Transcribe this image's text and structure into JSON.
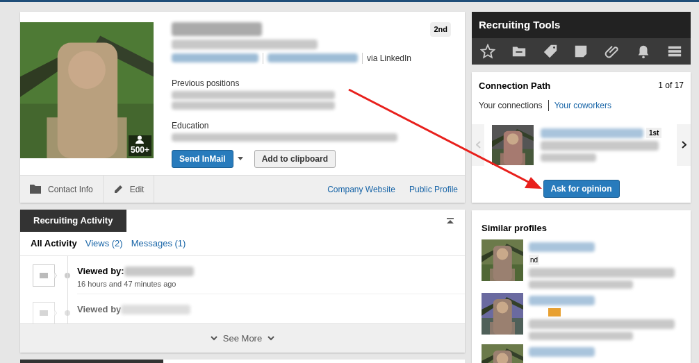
{
  "profile": {
    "degree": "2nd",
    "connections": "500+",
    "via": "via LinkedIn",
    "sections": [
      {
        "heading": "Previous positions"
      },
      {
        "heading": "Education"
      }
    ],
    "actions": [
      {
        "kind": "primary",
        "label": "Send InMail"
      },
      {
        "kind": "secondary",
        "label": "Add to clipboard"
      }
    ],
    "footer_left": [
      {
        "kind": "contact",
        "label": "Contact Info"
      },
      {
        "kind": "edit",
        "label": "Edit"
      }
    ],
    "footer_links": [
      "Company Website",
      "Public Profile"
    ]
  },
  "recruiting_activity": {
    "title": "Recruiting Activity",
    "tabs": [
      {
        "label": "All Activity",
        "selected": true
      },
      {
        "label": "Views (2)",
        "selected": false
      },
      {
        "label": "Messages (1)",
        "selected": false
      }
    ],
    "items": [
      {
        "label": "Viewed by:",
        "time": "16 hours and 47 minutes ago",
        "faded": false
      },
      {
        "label": "Viewed by",
        "faded": true
      }
    ],
    "see_more": "See More"
  },
  "recruiting_tools": {
    "title": "Recruiting Tools",
    "tools": [
      {
        "kind": "star"
      },
      {
        "kind": "folder"
      },
      {
        "kind": "tag"
      },
      {
        "kind": "note"
      },
      {
        "kind": "paperclip"
      },
      {
        "kind": "bell"
      },
      {
        "kind": "menu"
      }
    ]
  },
  "connection_path": {
    "title": "Connection Path",
    "count": "1 of 17",
    "tabs": [
      {
        "label": "Your connections",
        "selected": true
      },
      {
        "label": "Your coworkers",
        "selected": false
      }
    ],
    "degree": "1st",
    "button": "Ask for opinion"
  },
  "similar_profiles": {
    "title": "Similar profiles",
    "items": [
      {
        "badge": "nd",
        "kind": "degree"
      },
      {
        "kind": "in"
      },
      {
        "kind": "plain"
      }
    ]
  }
}
